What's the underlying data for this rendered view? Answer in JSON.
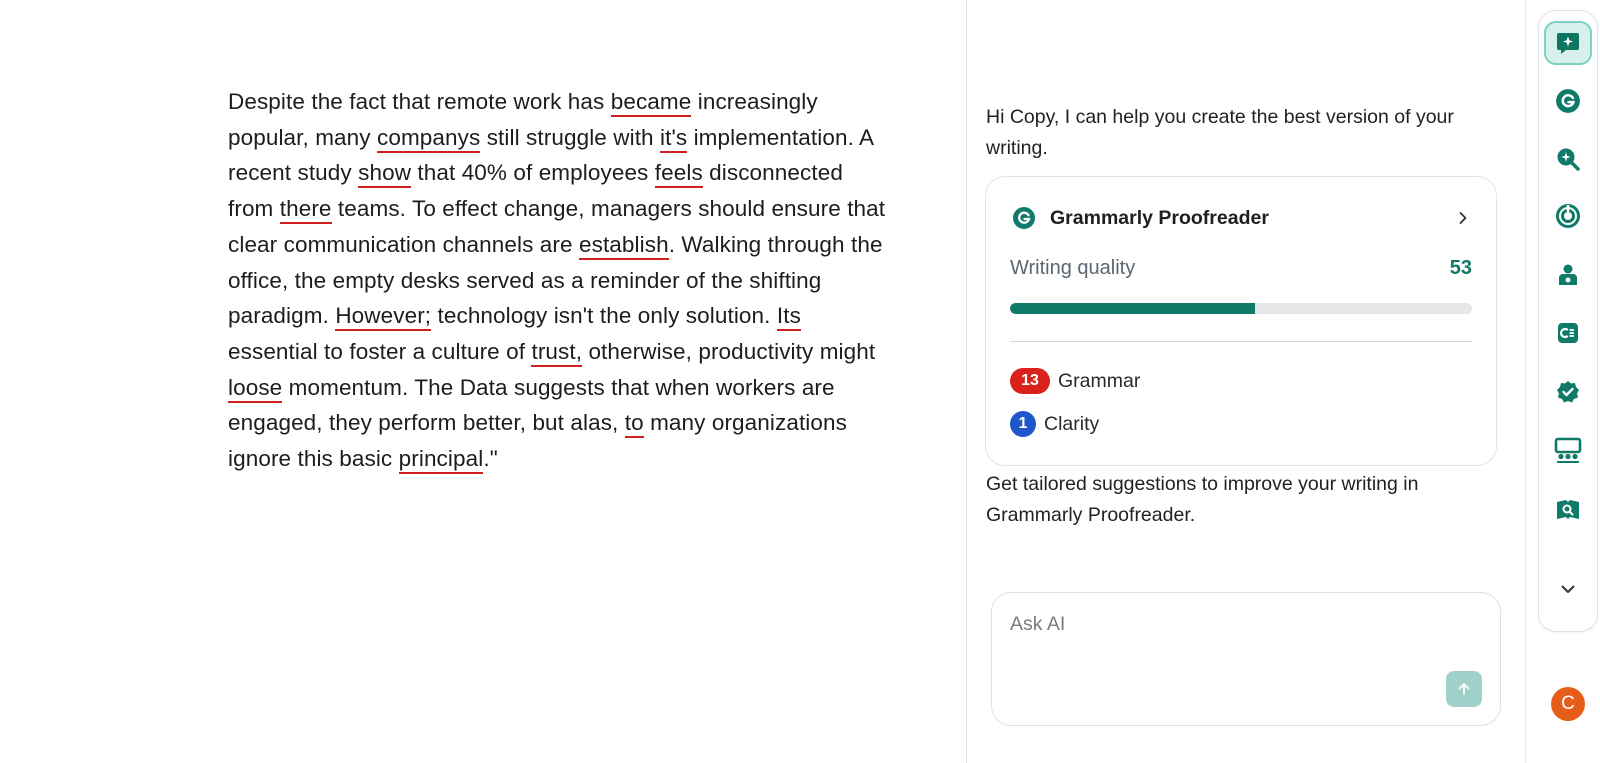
{
  "editor": {
    "segments": [
      {
        "text": "Despite the fact that remote work has ",
        "issue": false
      },
      {
        "text": "became",
        "issue": true
      },
      {
        "text": " increasingly popular, many ",
        "issue": false
      },
      {
        "text": "companys",
        "issue": true
      },
      {
        "text": " still struggle with ",
        "issue": false
      },
      {
        "text": "it's",
        "issue": true
      },
      {
        "text": " implementation. A recent study ",
        "issue": false
      },
      {
        "text": "show",
        "issue": true
      },
      {
        "text": " that 40% of employees ",
        "issue": false
      },
      {
        "text": "feels",
        "issue": true
      },
      {
        "text": " disconnected from ",
        "issue": false
      },
      {
        "text": "there",
        "issue": true
      },
      {
        "text": " teams. To effect change, managers should ensure that clear communication channels are ",
        "issue": false
      },
      {
        "text": "establish",
        "issue": true
      },
      {
        "text": ". Walking through the office, the empty desks served as a reminder of the shifting paradigm. ",
        "issue": false
      },
      {
        "text": "However;",
        "issue": true
      },
      {
        "text": " technology isn't the only solution. ",
        "issue": false
      },
      {
        "text": "Its",
        "issue": true
      },
      {
        "text": " essential to foster a culture of ",
        "issue": false
      },
      {
        "text": "trust,",
        "issue": true
      },
      {
        "text": " otherwise, productivity might ",
        "issue": false
      },
      {
        "text": "loose",
        "issue": true
      },
      {
        "text": " momentum. The Data suggests that when workers are engaged, they perform better, but alas, ",
        "issue": false
      },
      {
        "text": "to",
        "issue": true
      },
      {
        "text": " many organizations ignore this basic ",
        "issue": false
      },
      {
        "text": "principal",
        "issue": true
      },
      {
        "text": ".\"",
        "issue": false
      }
    ]
  },
  "assistant": {
    "greeting": "Hi Copy, I can help you create the best version of your writing.",
    "card": {
      "title": "Grammarly Proofreader",
      "quality_label": "Writing quality",
      "quality_score": "53",
      "quality_fraction": 0.53,
      "issues": [
        {
          "count": "13",
          "label": "Grammar",
          "color": "#d9221b"
        },
        {
          "count": "1",
          "label": "Clarity",
          "color": "#1d57c9"
        }
      ]
    },
    "tailored": "Get tailored suggestions to improve your writing in Grammarly Proofreader.",
    "ask": {
      "placeholder": "Ask AI",
      "value": ""
    }
  },
  "rail": {
    "items": [
      "ai-chat-icon",
      "grammarly-icon",
      "magic-search-icon",
      "detector-icon",
      "reader-icon",
      "citation-icon",
      "verified-icon",
      "audience-icon",
      "book-search-icon",
      "chevron-down-icon"
    ]
  },
  "user": {
    "initial": "C",
    "color": "#e55d19"
  },
  "colors": {
    "accent": "#107a68",
    "issue_underline": "#d11f1f"
  }
}
